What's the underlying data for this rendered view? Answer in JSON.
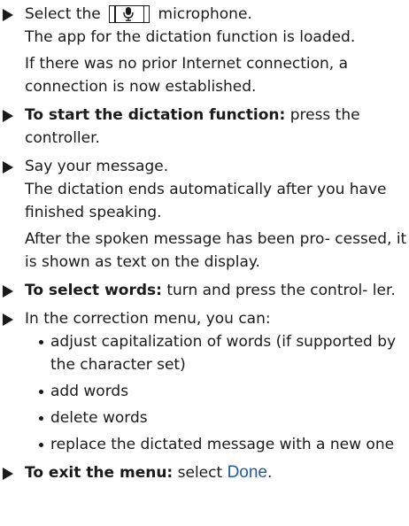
{
  "steps": {
    "s1": {
      "pre": "Select the",
      "post": "microphone.",
      "icon": "microphone-icon",
      "results": [
        "The app for the dictation function is loaded.",
        "If there was no prior Internet connection, a connection is now established."
      ]
    },
    "s2": {
      "bold": "To start the dictation function:",
      "text": " press the controller."
    },
    "s3": {
      "text": "Say your message.",
      "results": [
        "The dictation ends automatically after you have finished speaking.",
        "After the spoken message has been pro- cessed, it is shown as text on the display."
      ]
    },
    "s4": {
      "bold": "To select words:",
      "text": " turn and press the control- ler."
    },
    "s5": {
      "text": "In the correction menu, you can:",
      "bullets": [
        "adjust capitalization of words (if supported by the character set)",
        "add words",
        "delete words",
        "replace the dictated message with a new one"
      ]
    },
    "s6": {
      "bold": "To exit the menu:",
      "text": " select ",
      "link": "Done",
      "end": "."
    }
  },
  "colors": {
    "text": "#1a1a1a",
    "link": "#1f5aa6"
  }
}
